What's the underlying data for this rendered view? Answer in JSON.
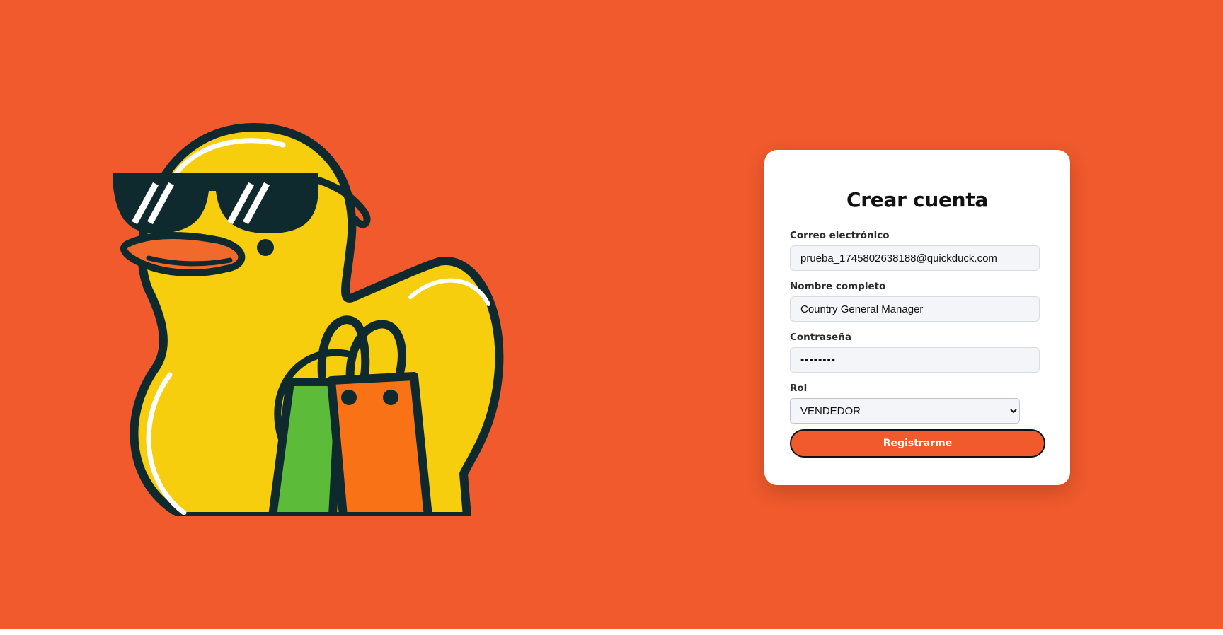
{
  "colors": {
    "background": "#F05A2C",
    "card": "#FFFFFF",
    "button": "#F05A2C",
    "input_background": "#F3F5F8",
    "duck_yellow": "#F7CE0E",
    "duck_outline": "#0E2A2E",
    "beak_orange": "#F26A2B",
    "bag_orange": "#F97316",
    "bag_green": "#5DBB3A"
  },
  "mascot": {
    "icon": "duck-with-sunglasses-and-shopping-bag"
  },
  "form": {
    "title": "Crear cuenta",
    "email": {
      "label": "Correo electrónico",
      "value": "prueba_1745802638188@quickduck.com"
    },
    "full_name": {
      "label": "Nombre completo",
      "value": "Country General Manager"
    },
    "password": {
      "label": "Contraseña",
      "value": "••••••••"
    },
    "role": {
      "label": "Rol",
      "selected": "VENDEDOR"
    },
    "submit_label": "Registrarme"
  }
}
